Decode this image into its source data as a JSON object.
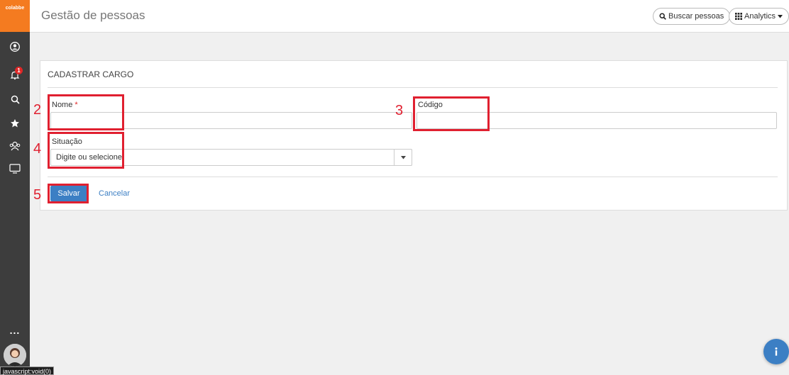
{
  "sidebar": {
    "logo_text": "colabbe",
    "notification_count": "1",
    "more_label": "...",
    "status_tip": "javascript:void(0)",
    "icons": [
      "profile-icon",
      "bell-icon",
      "search-icon",
      "star-icon",
      "team-icon",
      "monitor-icon"
    ]
  },
  "header": {
    "title": "Gestão de pessoas",
    "search_label": "Buscar pessoas",
    "analytics_label": "Analytics"
  },
  "form": {
    "title": "CADASTRAR CARGO",
    "name_label": "Nome",
    "required_mark": "*",
    "code_label": "Código",
    "status_label": "Situação",
    "status_placeholder": "Digite ou selecione",
    "save_label": "Salvar",
    "cancel_label": "Cancelar"
  },
  "annotations": {
    "n2": "2",
    "n3": "3",
    "n4": "4",
    "n5": "5"
  },
  "colors": {
    "brand_orange": "#f47b20",
    "sidebar_bg": "#3d3d3d",
    "primary_blue": "#3c7fc4",
    "annotation_red": "#e02030"
  }
}
